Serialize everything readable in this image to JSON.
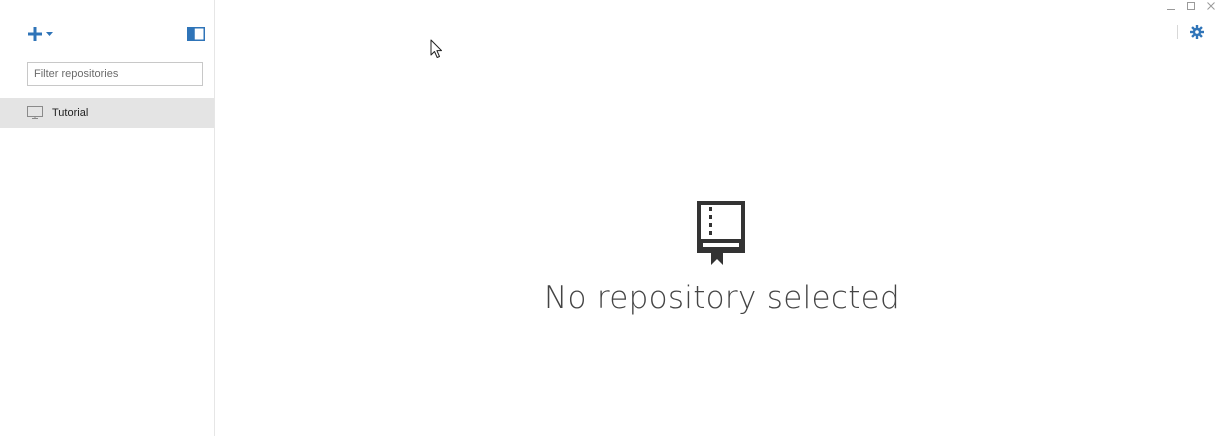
{
  "sidebar": {
    "add_button": {
      "icon": "plus-icon",
      "caret_icon": "caret-down-icon"
    },
    "panel_toggle": {
      "icon": "sidebar-toggle-icon"
    },
    "filter": {
      "placeholder": "Filter repositories",
      "value": ""
    },
    "repositories": [
      {
        "label": "Tutorial",
        "icon": "monitor-icon",
        "selected": true
      }
    ]
  },
  "window": {
    "minimize_glyph": "–",
    "maximize_glyph": "□",
    "close_glyph": "✕"
  },
  "toolbar": {
    "settings_icon": "gear-icon"
  },
  "main": {
    "empty_state": {
      "icon": "repo-book-icon",
      "message": "No repository selected"
    }
  },
  "colors": {
    "accent": "#2f74b8",
    "selected_row": "#e4e4e4",
    "icon_dark": "#333333"
  }
}
